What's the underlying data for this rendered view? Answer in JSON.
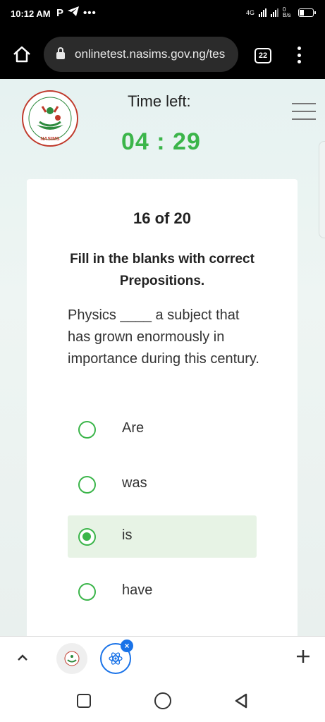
{
  "status_bar": {
    "time": "10:12 AM",
    "network": "4G",
    "speed": "0 B/s",
    "left_icons": [
      "p-icon",
      "telegram-icon",
      "more-dots-icon"
    ],
    "right_icons": [
      "signal-icon",
      "signal-icon",
      "battery-icon"
    ]
  },
  "browser": {
    "url": "onlinetest.nasims.gov.ng/tes",
    "tab_count": "22"
  },
  "header": {
    "logo_text": "NASIMS",
    "time_label": "Time left:",
    "timer": "04 : 29"
  },
  "quiz": {
    "counter": "16 of 20",
    "instruction": "Fill in the blanks with correct Prepositions.",
    "question": "Physics ____ a subject that has grown enormously in importance during this century.",
    "options": [
      {
        "label": "Are",
        "selected": false
      },
      {
        "label": "was",
        "selected": false
      },
      {
        "label": "is",
        "selected": true
      },
      {
        "label": "have",
        "selected": false
      }
    ]
  },
  "toolbar": {
    "close_badge": "×"
  },
  "colors": {
    "accent_green": "#3bb54a",
    "selected_bg": "#e7f3e5",
    "browser_blue": "#1a73e8"
  }
}
